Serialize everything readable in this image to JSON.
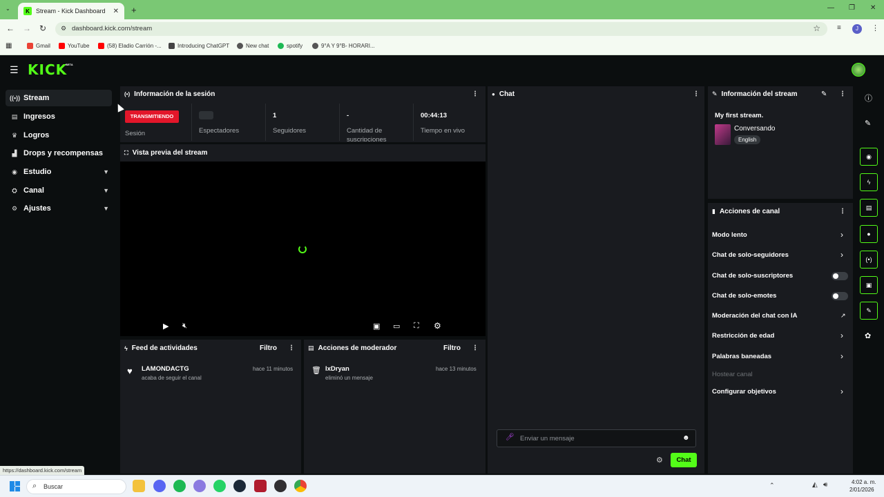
{
  "browser": {
    "tab_title": "Stream - Kick Dashboard",
    "url": "dashboard.kick.com/stream",
    "bookmarks": [
      "Gmail",
      "YouTube",
      "(58) Eladio Carrión -...",
      "Introducing ChatGPT",
      "New chat",
      "spotify",
      "9°A Y 9°B- HORARI..."
    ],
    "profile_initial": "J"
  },
  "app": {
    "logo": "KICK",
    "beta": "BETA"
  },
  "sidebar": {
    "items": [
      {
        "label": "Stream"
      },
      {
        "label": "Ingresos"
      },
      {
        "label": "Logros"
      },
      {
        "label": "Drops y recompensas"
      },
      {
        "label": "Estudio"
      },
      {
        "label": "Canal"
      },
      {
        "label": "Ajustes"
      }
    ]
  },
  "session": {
    "title": "Información de la sesión",
    "live_badge": "TRANSMITIENDO",
    "session_label": "Sesión",
    "viewers_label": "Espectadores",
    "followers_value": "1",
    "followers_label": "Seguidores",
    "subs_value": "-",
    "subs_label": "Cantidad de suscripciones",
    "live_time_value": "00:44:13",
    "live_time_label": "Tiempo en vivo"
  },
  "preview": {
    "title": "Vista previa del stream"
  },
  "activity": {
    "title": "Feed de actividades",
    "filter": "Filtro",
    "user": "LAMONDACTG",
    "action": "acaba de seguir el canal",
    "time": "hace 11 minutos"
  },
  "modactions": {
    "title": "Acciones de moderador",
    "filter": "Filtro",
    "user": "IxDryan",
    "action": "eliminó un mensaje",
    "time": "hace 13 minutos"
  },
  "chat": {
    "title": "Chat",
    "placeholder": "Enviar un mensaje",
    "send_label": "Chat"
  },
  "stream_info": {
    "title": "Información del stream",
    "stream_title": "My first stream.",
    "category": "Conversando",
    "language": "English"
  },
  "channel_actions": {
    "title": "Acciones de canal",
    "items": {
      "slow": "Modo lento",
      "followers": "Chat de solo-seguidores",
      "subs": "Chat de solo-suscriptores",
      "emotes": "Chat de solo-emotes",
      "ai_mod": "Moderación del chat con IA",
      "age": "Restricción de edad",
      "banned": "Palabras baneadas",
      "host": "Hostear canal",
      "goals": "Configurar objetivos"
    }
  },
  "status_url": "https://dashboard.kick.com/stream",
  "taskbar": {
    "search": "Buscar",
    "time": "4:02 a. m.",
    "date": "2/01/2026"
  },
  "colors": {
    "accent": "#53fc18",
    "live": "#e3162a",
    "panel": "#191b1f"
  }
}
